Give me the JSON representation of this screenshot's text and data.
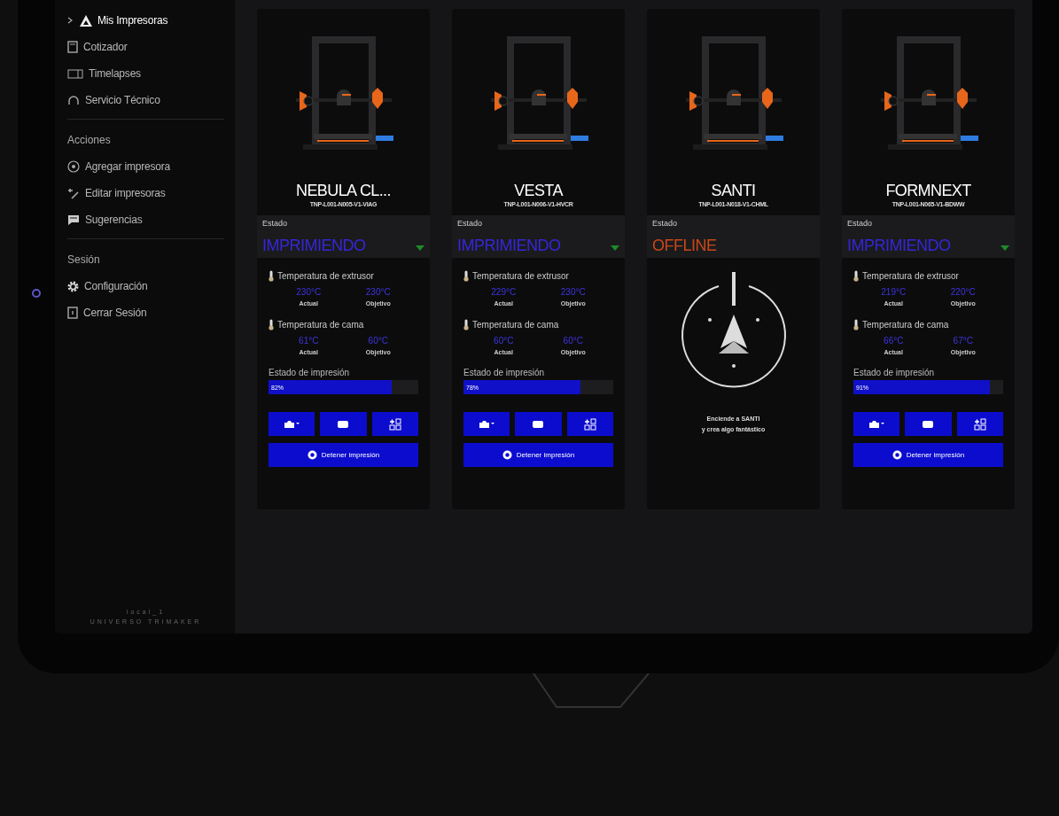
{
  "sidebar": {
    "nav": [
      {
        "label": "Mis Impresoras",
        "selected": true
      },
      {
        "label": "Cotizador",
        "selected": false
      },
      {
        "label": "Timelapses",
        "selected": false
      },
      {
        "label": "Servicio Técnico",
        "selected": false
      }
    ],
    "sections": [
      {
        "title": "Acciones",
        "items": [
          "Agregar impresora",
          "Editar impresoras",
          "Sugerencias"
        ]
      },
      {
        "title": "Sesión",
        "items": [
          "Configuración",
          "Cerrar Sesión"
        ]
      }
    ],
    "footer": [
      "local_1",
      "UNIVERSO TRIMAKER"
    ]
  },
  "printers": [
    {
      "kind": "printing",
      "name": "NEBULA CL...",
      "serial": "TNP-L001-N005-V1-VIAG",
      "status_label": "Estado",
      "status": "IMPRIMIENDO",
      "extruder": {
        "title": "Temperatura de extrusor",
        "actual": "230°C",
        "actual_label": "Actual",
        "target": "230°C",
        "target_label": "Objetivo"
      },
      "bed": {
        "title": "Temperatura de cama",
        "actual": "61°C",
        "actual_label": "Actual",
        "target": "60°C",
        "target_label": "Objetivo"
      },
      "progress": {
        "label": "Estado de impresión",
        "reading": "82%",
        "level": 0.82
      },
      "stop_button": "Detener impresión"
    },
    {
      "kind": "printing",
      "name": "VESTA",
      "serial": "TNP-L001-N006-V1-HVCR",
      "status_label": "Estado",
      "status": "IMPRIMIENDO",
      "extruder": {
        "title": "Temperatura de extrusor",
        "actual": "229°C",
        "actual_label": "Actual",
        "target": "230°C",
        "target_label": "Objetivo"
      },
      "bed": {
        "title": "Temperatura de cama",
        "actual": "60°C",
        "actual_label": "Actual",
        "target": "60°C",
        "target_label": "Objetivo"
      },
      "progress": {
        "label": "Estado de impresión",
        "reading": "78%",
        "level": 0.78
      },
      "stop_button": "Detener impresión"
    },
    {
      "kind": "offline",
      "name": "SANTI",
      "serial": "TNP-L001-N018-V1-CHML",
      "status_label": "Estado",
      "status": "OFFLINE",
      "message": [
        "Enciende a SANTI",
        "y crea algo fantástico"
      ]
    },
    {
      "kind": "printing",
      "name": "FORMNEXT",
      "serial": "TNP-L001-N065-V1-BDWW",
      "status_label": "Estado",
      "status": "IMPRIMIENDO",
      "extruder": {
        "title": "Temperatura de extrusor",
        "actual": "219°C",
        "actual_label": "Actual",
        "target": "220°C",
        "target_label": "Objetivo"
      },
      "bed": {
        "title": "Temperatura de cama",
        "actual": "66°C",
        "actual_label": "Actual",
        "target": "67°C",
        "target_label": "Objetivo"
      },
      "progress": {
        "label": "Estado de impresión",
        "reading": "91%",
        "level": 0.91
      },
      "stop_button": "Detener impresión"
    }
  ]
}
